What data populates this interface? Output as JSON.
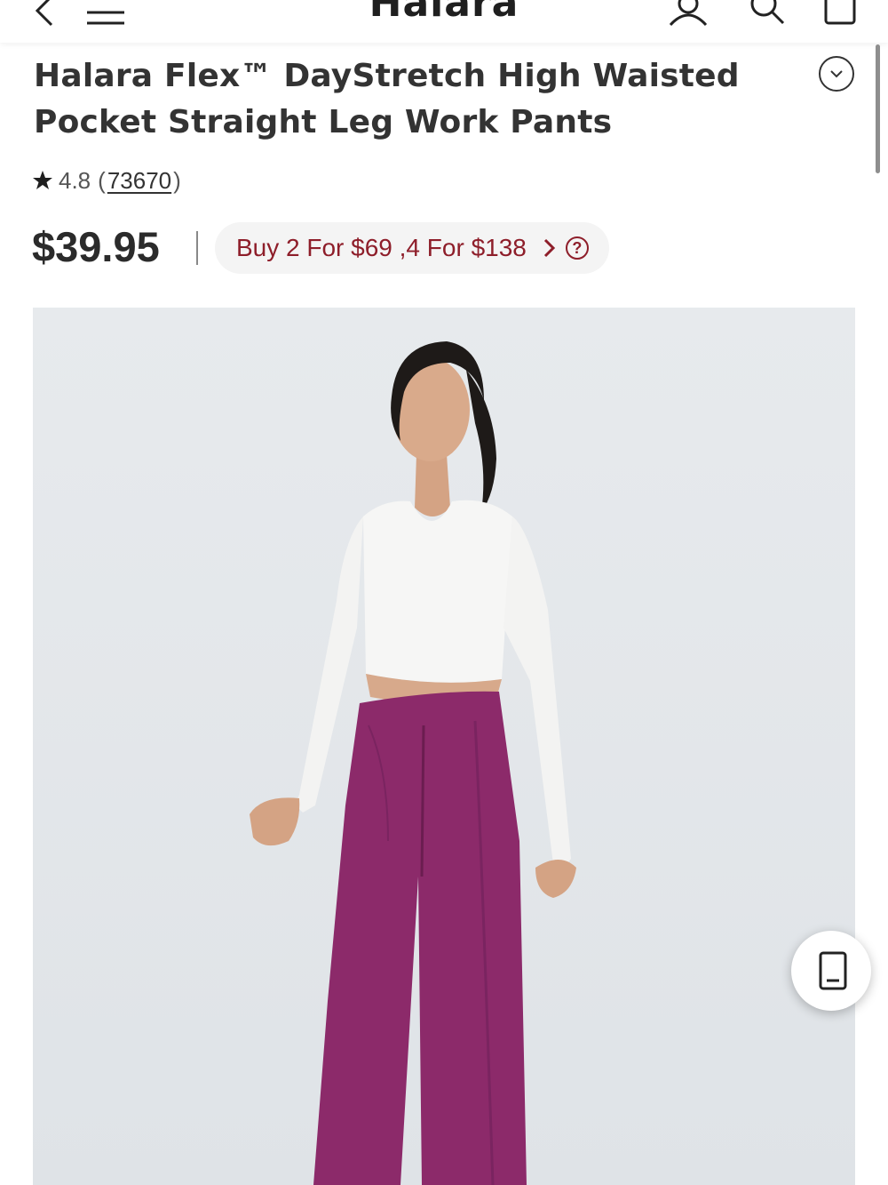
{
  "header": {
    "brand": "Halara",
    "icons": [
      "back-arrow-icon",
      "menu-icon",
      "account-icon",
      "search-icon",
      "cart-icon"
    ]
  },
  "product": {
    "title_line1": "Halara Flex™ DayStretch High Waisted",
    "title_line2": "Pocket Straight Leg Work Pants",
    "rating": "4.8",
    "rating_open": "(",
    "review_count": "73670",
    "rating_close": ")",
    "price": "$39.95",
    "promo_text": "Buy 2 For $69 ,4 For $138"
  },
  "colors": {
    "accent_red": "#8e1e2a",
    "text_dark": "#333333",
    "pants_purple": "#8c2a6a",
    "image_background": "#e3e6ea"
  },
  "floating_button": {
    "icon": "mobile-phone-icon"
  }
}
